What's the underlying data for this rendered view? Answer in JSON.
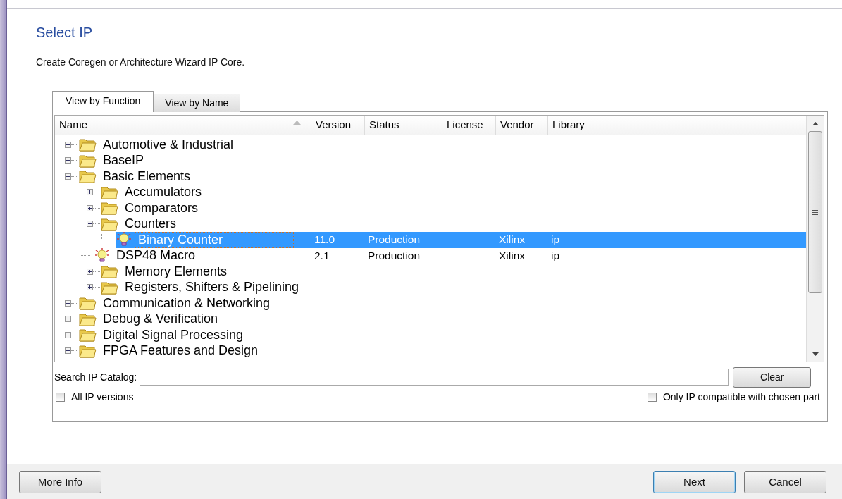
{
  "header": {
    "title": "Select IP",
    "subtitle": "Create Coregen or Architecture Wizard IP Core."
  },
  "tabs": [
    {
      "label": "View by Function",
      "selected": true
    },
    {
      "label": "View by Name",
      "selected": false
    }
  ],
  "table": {
    "columns": [
      {
        "label": "Name",
        "sorted": true
      },
      {
        "label": "Version",
        "sorted": false
      },
      {
        "label": "Status",
        "sorted": false
      },
      {
        "label": "License",
        "sorted": false
      },
      {
        "label": "Vendor",
        "sorted": false
      },
      {
        "label": "Library",
        "sorted": false
      }
    ],
    "rows": [
      {
        "kind": "folder",
        "name": "Automotive & Industrial",
        "expanded": false,
        "selected": false
      },
      {
        "kind": "folder",
        "name": "BaseIP",
        "expanded": false,
        "selected": false
      },
      {
        "kind": "folder",
        "name": "Basic Elements",
        "expanded": true,
        "selected": false,
        "children": [
          {
            "kind": "folder",
            "name": "Accumulators",
            "expanded": false,
            "selected": false
          },
          {
            "kind": "folder",
            "name": "Comparators",
            "expanded": false,
            "selected": false
          },
          {
            "kind": "folder",
            "name": "Counters",
            "expanded": true,
            "selected": false,
            "children": [
              {
                "kind": "ip",
                "name": "Binary Counter",
                "selected": true,
                "version": "11.0",
                "status": "Production",
                "vendor": "Xilinx",
                "library": "ip"
              }
            ]
          },
          {
            "kind": "ip",
            "name": "DSP48 Macro",
            "selected": false,
            "version": "2.1",
            "status": "Production",
            "vendor": "Xilinx",
            "library": "ip"
          },
          {
            "kind": "folder",
            "name": "Memory Elements",
            "expanded": false,
            "selected": false
          },
          {
            "kind": "folder",
            "name": "Registers, Shifters & Pipelining",
            "expanded": false,
            "selected": false
          }
        ]
      },
      {
        "kind": "folder",
        "name": "Communication & Networking",
        "expanded": false,
        "selected": false
      },
      {
        "kind": "folder",
        "name": "Debug & Verification",
        "expanded": false,
        "selected": false
      },
      {
        "kind": "folder",
        "name": "Digital Signal Processing",
        "expanded": false,
        "selected": false
      },
      {
        "kind": "folder",
        "name": "FPGA Features and Design",
        "expanded": false,
        "selected": false
      }
    ]
  },
  "search": {
    "label": "Search IP Catalog:",
    "button": "Clear"
  },
  "options": [
    {
      "label": "All IP versions",
      "checked": false
    },
    {
      "label": "Only IP compatible with chosen part",
      "checked": false
    }
  ],
  "buttons": {
    "left": [
      "More Info"
    ],
    "right": [
      "Next",
      "Cancel"
    ]
  }
}
